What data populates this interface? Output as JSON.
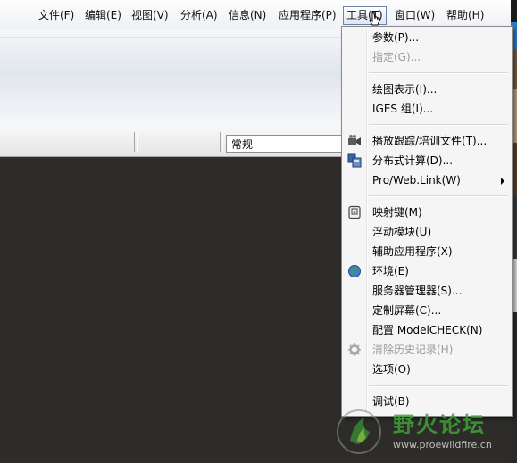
{
  "menubar": {
    "items": [
      "文件(F)",
      "编辑(E)",
      "视图(V)",
      "分析(A)",
      "信息(N)",
      "应用程序(P)",
      "工具(T)",
      "窗口(W)",
      "帮助(H)"
    ]
  },
  "status": {
    "combo_value": "常规"
  },
  "tools_menu": {
    "items": [
      {
        "label": "参数(P)...",
        "icon": "",
        "disabled": false
      },
      {
        "label": "指定(G)...",
        "icon": "",
        "disabled": true
      },
      {
        "label": "绘图表示(I)...",
        "icon": "",
        "disabled": false
      },
      {
        "label": "IGES 组(I)...",
        "icon": "",
        "disabled": false
      },
      {
        "label": "播放跟踪/培训文件(T)...",
        "icon": "playback-camera-icon",
        "disabled": false
      },
      {
        "label": "分布式计算(D)...",
        "icon": "distributed-computing-icon",
        "disabled": false
      },
      {
        "label": "Pro/Web.Link(W)",
        "icon": "",
        "disabled": false,
        "submenu": true
      },
      {
        "label": "映射键(M)",
        "icon": "mapkey-icon",
        "disabled": false
      },
      {
        "label": "浮动模块(U)",
        "icon": "",
        "disabled": false
      },
      {
        "label": "辅助应用程序(X)",
        "icon": "",
        "disabled": false
      },
      {
        "label": "环境(E)",
        "icon": "globe-icon",
        "disabled": false
      },
      {
        "label": "服务器管理器(S)...",
        "icon": "",
        "disabled": false
      },
      {
        "label": "定制屏幕(C)...",
        "icon": "",
        "disabled": false
      },
      {
        "label": "配置 ModelCHECK(N)",
        "icon": "",
        "disabled": false
      },
      {
        "label": "清除历史记录(H)",
        "icon": "gear-icon",
        "disabled": true
      },
      {
        "label": "选项(O)",
        "icon": "",
        "disabled": false
      },
      {
        "label": "调试(B)",
        "icon": "",
        "disabled": false
      }
    ]
  },
  "watermark": {
    "title": "野火论坛",
    "url": "www.proewildfire.cn"
  },
  "colors": {
    "graphics_bg": "#2d2c28",
    "menu_bg": "#f5f5f5",
    "disabled_text": "#9b9b9b",
    "watermark_green": "#3fa03a"
  }
}
